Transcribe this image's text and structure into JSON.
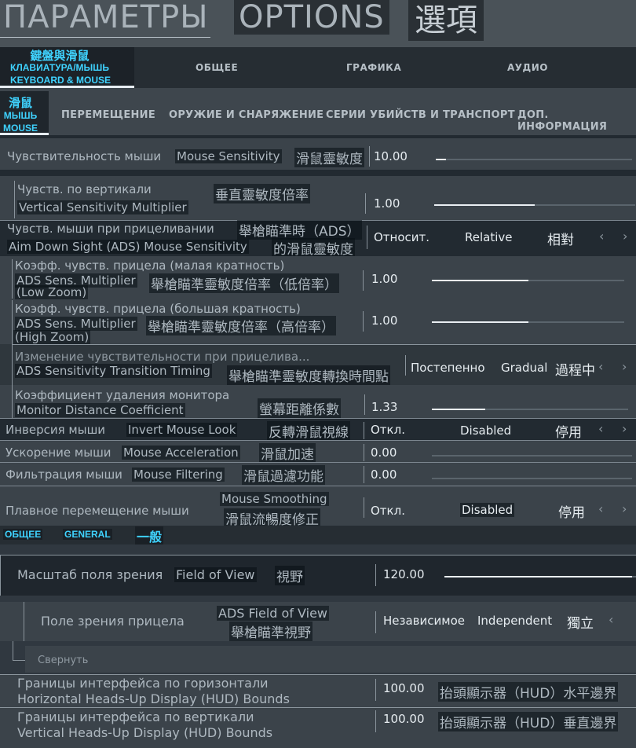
{
  "header": {
    "title_ru": "ПАРАМЕТРЫ",
    "title_en": "OPTIONS",
    "title_zh": "選項"
  },
  "top_tabs": {
    "active": {
      "zh": "鍵盤與滑鼠",
      "ru": "КЛАВИАТУРА/МЫШЬ",
      "en": "KEYBOARD & MOUSE"
    },
    "items": [
      "ОБЩЕЕ",
      "ГРАФИКА",
      "АУДИО"
    ]
  },
  "sub_tabs": {
    "active": {
      "zh": "滑鼠",
      "ru": "МЫШЬ",
      "en": "MOUSE"
    },
    "items": [
      "ПЕРЕМЕЩЕНИЕ",
      "ОРУЖИЕ И СНАРЯЖЕНИЕ",
      "СЕРИИ УБИЙСТВ И ТРАНСПОРТ",
      "ДОП. ИНФОРМАЦИЯ"
    ]
  },
  "settings": {
    "mouse_sensitivity": {
      "ru": "Чувствительность мыши",
      "en": "Mouse Sensitivity",
      "zh": "滑鼠靈敏度",
      "value": "10.00",
      "fill": 0.05
    },
    "vertical_multiplier": {
      "ru": "Чувств. по вертикали",
      "en": "Vertical Sensitivity Multiplier",
      "zh": "垂直靈敏度倍率",
      "value": "1.00",
      "fill": 0.5
    },
    "ads_sensitivity": {
      "ru": "Чувств. мыши при прицеливании",
      "en": "Aim Down Sight (ADS) Mouse Sensitivity",
      "zh1": "舉槍瞄準時（ADS）",
      "zh2": "的滑鼠靈敏度",
      "opt_ru": "Относит.",
      "opt_en": "Relative",
      "opt_zh": "相對"
    },
    "ads_low": {
      "ru": "Коэфф. чувств. прицела (малая кратность)",
      "en1": "ADS Sens. Multiplier",
      "en2": "(Low Zoom)",
      "zh": "舉槍瞄準靈敏度倍率（低倍率）",
      "value": "1.00",
      "fill": 0.5
    },
    "ads_high": {
      "ru": "Коэфф. чувств. прицела (большая кратность)",
      "en1": "ADS Sens. Multiplier",
      "en2": "(High Zoom)",
      "zh": "舉槍瞄準靈敏度倍率（高倍率）",
      "value": "1.00",
      "fill": 0.5
    },
    "transition_timing": {
      "ru": "Изменение чувствительности при прицелива...",
      "en": "ADS Sensitivity Transition Timing",
      "zh": "舉槍瞄準靈敏度轉換時間點",
      "opt_ru": "Постепенно",
      "opt_en": "Gradual",
      "opt_zh": "過程中"
    },
    "monitor_distance": {
      "ru": "Коэффициент удаления монитора",
      "en": "Monitor Distance Coefficient",
      "zh": "螢幕距離係數",
      "value": "1.33",
      "fill": 0.27
    },
    "invert_mouse": {
      "ru": "Инверсия мыши",
      "en": "Invert Mouse Look",
      "zh": "反轉滑鼠視線",
      "opt_ru": "Откл.",
      "opt_en": "Disabled",
      "opt_zh": "停用"
    },
    "mouse_acceleration": {
      "ru": "Ускорение мыши",
      "en": "Mouse Acceleration",
      "zh": "滑鼠加速",
      "value": "0.00"
    },
    "mouse_filtering": {
      "ru": "Фильтрация мыши",
      "en": "Mouse Filtering",
      "zh": "滑鼠過濾功能",
      "value": "0.00"
    },
    "mouse_smoothing": {
      "ru": "Плавное перемещение мыши",
      "en": "Mouse Smoothing",
      "zh": "滑鼠流暢度修正",
      "opt_ru": "Откл.",
      "opt_en": "Disabled",
      "opt_zh": "停用"
    }
  },
  "general_tabs": {
    "ru": "ОБЩЕЕ",
    "en": "GENERAL",
    "zh": "一般"
  },
  "general": {
    "fov": {
      "ru": "Масштаб поля зрения",
      "en": "Field of View",
      "zh": "視野",
      "value": "120.00",
      "fill": 0.98
    },
    "ads_fov": {
      "ru": "Поле зрения прицела",
      "en": "ADS Field of View",
      "zh": "舉槍瞄準視野",
      "opt_ru": "Независимое",
      "opt_en": "Independent",
      "opt_zh": "獨立"
    },
    "collapse": "Свернуть",
    "hud_h": {
      "ru": "Границы интерфейса по горизонтали",
      "en": "Horizontal Heads-Up Display (HUD) Bounds",
      "zh": "抬頭顯示器（HUD）水平邊界",
      "value": "100.00"
    },
    "hud_v": {
      "ru": "Границы интерфейса по вертикали",
      "en": "Vertical Heads-Up Display (HUD) Bounds",
      "zh": "抬頭顯示器（HUD）垂直邊界",
      "value": "100.00"
    }
  },
  "icons": {
    "left": "chevron-left-icon",
    "right": "chevron-right-icon"
  },
  "glyphs": {
    "left": "‹",
    "right": "›"
  }
}
